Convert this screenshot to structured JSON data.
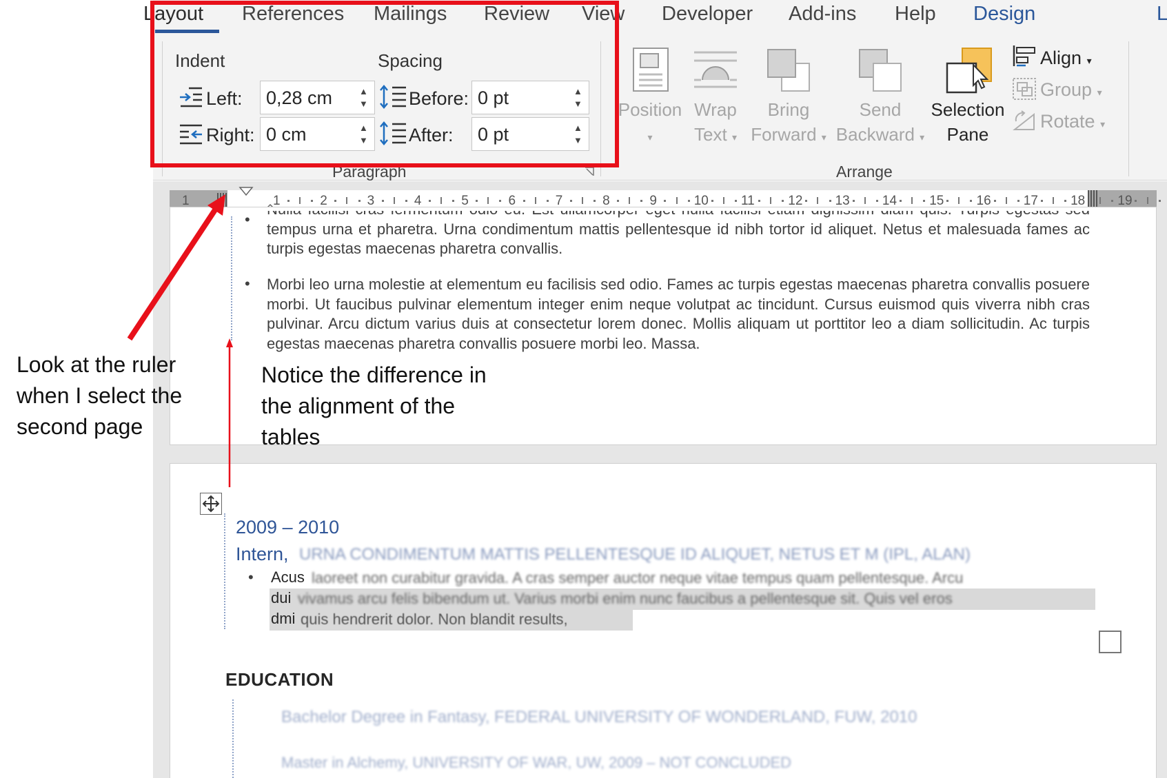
{
  "ribbon": {
    "tabs": [
      {
        "label": "Layout",
        "active": true
      },
      {
        "label": "References"
      },
      {
        "label": "Mailings"
      },
      {
        "label": "Review"
      },
      {
        "label": "View"
      },
      {
        "label": "Developer"
      },
      {
        "label": "Add-ins"
      },
      {
        "label": "Help"
      },
      {
        "label": "Design"
      },
      {
        "label": "L"
      }
    ],
    "paragraph": {
      "indent_label": "Indent",
      "spacing_label": "Spacing",
      "left_label": "Left:",
      "left_value": "0,28 cm",
      "right_label": "Right:",
      "right_value": "0 cm",
      "before_label": "Before:",
      "before_value": "0 pt",
      "after_label": "After:",
      "after_value": "0 pt",
      "group_label": "Paragraph",
      "launcher_icon": "dialog-launcher-icon"
    },
    "arrange": {
      "position": "Position",
      "wrap_text_1": "Wrap",
      "wrap_text_2": "Text",
      "bring_forward_1": "Bring",
      "bring_forward_2": "Forward",
      "send_backward_1": "Send",
      "send_backward_2": "Backward",
      "selection_pane_1": "Selection",
      "selection_pane_2": "Pane",
      "align": "Align",
      "group": "Group",
      "rotate": "Rotate",
      "group_label": "Arrange"
    },
    "accent_color": "#2b579a"
  },
  "ruler": {
    "left_numbers": [
      "1"
    ],
    "numbers": [
      "1",
      "2",
      "3",
      "4",
      "5",
      "6",
      "7",
      "8",
      "9",
      "10",
      "11",
      "12",
      "13",
      "14",
      "15",
      "16",
      "17",
      "18",
      "19"
    ]
  },
  "document": {
    "page1": {
      "bullet_1": "Nulla facilisi cras fermentum odio eu. Est ullamcorper eget nulla facilisi etiam dignissim diam quis. Turpis egestas sed tempus urna et pharetra. Urna condimentum mattis pellentesque id nibh tortor id aliquet. Netus et malesuada fames ac turpis egestas maecenas pharetra convallis.",
      "bullet_2": "Morbi leo urna molestie at elementum eu facilisis sed odio. Fames ac turpis egestas maecenas pharetra convallis posuere morbi. Ut faucibus pulvinar elementum integer enim neque volutpat ac tincidunt. Cursus euismod quis viverra nibh cras pulvinar. Arcu dictum varius duis at consectetur lorem donec. Mollis aliquam ut porttitor leo a diam sollicitudin. Ac turpis egestas maecenas pharetra convallis posuere morbi leo. Massa."
    },
    "page2": {
      "years": "2009 – 2010",
      "role": "Intern,",
      "role_detail": "URNA CONDIMENTUM MATTIS PELLENTESQUE ID ALIQUET, NETUS ET M (IPL, ALAN)",
      "bullet_lead": "Acus",
      "bullet_text": "laoreet non curabitur gravida. A cras semper auctor neque vitae tempus quam pellentesque. Arcu",
      "line2_lead": "dui",
      "line2_text": "vivamus arcu felis bibendum ut. Varius morbi enim nunc faucibus a pellentesque sit. Quis vel eros",
      "line3_lead": "dmi",
      "line3_text": "quis hendrerit dolor. Non blandit results,",
      "education_heading": "EDUCATION",
      "edu_1": "Bachelor Degree in Fantasy, FEDERAL UNIVERSITY OF WONDERLAND, FUW, 2010",
      "edu_2": "Master in Alchemy, UNIVERSITY OF WAR, UW, 2009 – NOT CONCLUDED"
    }
  },
  "annotations": {
    "ruler_note": [
      "Look at the ruler",
      "when I select the",
      "second page"
    ],
    "alignment_note": [
      "Notice the difference in",
      "the alignment of the",
      "tables"
    ],
    "color": "#e8101a"
  }
}
